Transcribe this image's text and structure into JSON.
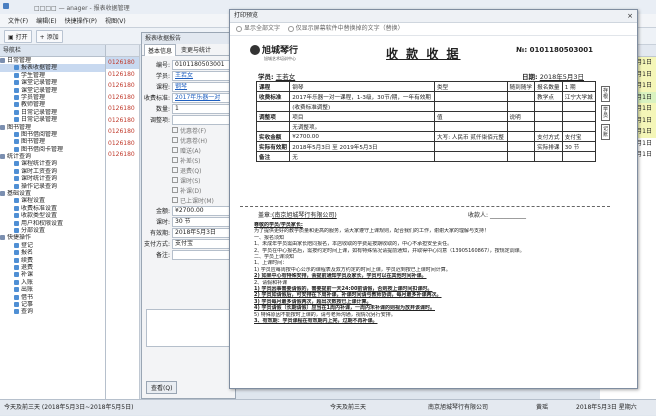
{
  "window": {
    "title": "□□□□ — anager - 报表收据管理"
  },
  "menu": [
    "文件(F)",
    "编辑(E)",
    "快捷操作(P)",
    "视图(V)"
  ],
  "toolbar": {
    "open": "打开",
    "add": "添加"
  },
  "sidebar": {
    "header": "导航栏",
    "items": [
      {
        "label": "日常管理",
        "level": 0
      },
      {
        "label": "报表收据管理",
        "level": 1
      },
      {
        "label": "学生管理",
        "level": 1
      },
      {
        "label": "课堂记录管理",
        "level": 1
      },
      {
        "label": "课堂记录管理",
        "level": 1
      },
      {
        "label": "学员管理",
        "level": 1
      },
      {
        "label": "教师管理",
        "level": 1
      },
      {
        "label": "日常记录管理",
        "level": 1
      },
      {
        "label": "日常记录管理",
        "level": 1
      },
      {
        "label": "图书管理",
        "level": 0
      },
      {
        "label": "图书借阅管理",
        "level": 1
      },
      {
        "label": "图书管理",
        "level": 1
      },
      {
        "label": "图书借阅卡管理",
        "level": 1
      },
      {
        "label": "统计查询",
        "level": 0
      },
      {
        "label": "课程统计查询",
        "level": 1
      },
      {
        "label": "课时工资查询",
        "level": 1
      },
      {
        "label": "课时统计查询",
        "level": 1
      },
      {
        "label": "操作记录查询",
        "level": 1
      },
      {
        "label": "基础设置",
        "level": 0
      },
      {
        "label": "课程设置",
        "level": 1
      },
      {
        "label": "收费标准设置",
        "level": 1
      },
      {
        "label": "收款类型设置",
        "level": 1
      },
      {
        "label": "用户和权限设置",
        "level": 1
      },
      {
        "label": "分部设置",
        "level": 1
      },
      {
        "label": "快捷操作",
        "level": 0
      },
      {
        "label": "登记",
        "level": 1
      },
      {
        "label": "报名",
        "level": 1
      },
      {
        "label": "续费",
        "level": 1
      },
      {
        "label": "退费",
        "level": 1
      },
      {
        "label": "补课",
        "level": 1
      },
      {
        "label": "入账",
        "level": 1
      },
      {
        "label": "出账",
        "level": 1
      },
      {
        "label": "借书",
        "level": 1
      },
      {
        "label": "记事",
        "level": 1
      },
      {
        "label": "查询",
        "level": 1
      }
    ]
  },
  "list": {
    "rows": [
      "0126180",
      "0126180",
      "0126180",
      "0126180",
      "0126180",
      "0126180",
      "0126180",
      "0126180",
      "0126180"
    ]
  },
  "form": {
    "title": "报表收据报告",
    "tabs": [
      "基本信息",
      "变更与统计"
    ],
    "fields": [
      {
        "label": "编号:",
        "value": "0101180503001",
        "link": false
      },
      {
        "label": "学员:",
        "value": "王若女",
        "link": true
      },
      {
        "label": "课程:",
        "value": "钢琴",
        "link": true
      },
      {
        "label": "收费标准:",
        "value": "2017年乐器一对",
        "link": true
      },
      {
        "label": "数量:",
        "value": "1",
        "link": false
      },
      {
        "label": "调整项:",
        "value": "",
        "link": false
      }
    ],
    "checks": [
      "优惠卷(F)",
      "优惠卷(H)",
      "赠送(A)",
      "补差(S)",
      "退费(Q)",
      "课时(S)",
      "补课(D)",
      "已上课时(M)"
    ],
    "fields2": [
      {
        "label": "金额:",
        "value": "¥2700.00"
      },
      {
        "label": "课时:",
        "value": "30 节"
      },
      {
        "label": "有效期:",
        "value": "2018年5月3日"
      },
      {
        "label": "支付方式:",
        "value": "支付宝"
      },
      {
        "label": "备注:",
        "value": ""
      }
    ],
    "query_btn": "查看(Q)"
  },
  "right": {
    "cells": [
      {
        "text": "4月1日",
        "style": "y"
      },
      {
        "text": "4月1日",
        "style": "y"
      },
      {
        "text": "4月1日",
        "style": "y"
      },
      {
        "text": "4月1日",
        "style": "g"
      },
      {
        "text": "4月1日",
        "style": "y"
      },
      {
        "text": "4月1日",
        "style": "y"
      },
      {
        "text": "4月1日",
        "style": "y"
      },
      {
        "text": "4月1日",
        "style": ""
      },
      {
        "text": "4月1日",
        "style": ""
      }
    ]
  },
  "preview": {
    "title": "打印预览",
    "close": "×",
    "opt1": "显示全部文字",
    "opt2": "仅显示屏幕软件中替换掉的文字（替换）",
    "receipt": {
      "logo": "旭城琴行",
      "logo_sub": "旭城艺术培训中心",
      "title": "收 款 收 据",
      "no_label": "№:",
      "no": "0101180503001",
      "student_label": "学员:",
      "student": "王若女",
      "date_label": "日期:",
      "date": "2018年5月3日",
      "rows": [
        [
          "课程",
          "钢琴",
          "类型",
          "随到随学",
          "报名数量",
          "1 期"
        ],
        [
          "收费标准",
          "2017年乐器一对一课程，1-3级，30节/期，一年有效期",
          "",
          "",
          "教学点",
          "江宁大学城"
        ],
        [
          "",
          "(收费标准调整)",
          "",
          "",
          "",
          ""
        ],
        [
          "调整项",
          "项目",
          "值",
          "说明",
          "",
          ""
        ],
        [
          "",
          "无调整项。",
          "",
          "",
          "",
          ""
        ],
        [
          "实收金额",
          "¥2700.00",
          "大写: 人民币 贰仟柒佰元整",
          "",
          "支付方式",
          "支付宝"
        ],
        [
          "实际有效期",
          "2018年5月3日 至 2019年5月3日",
          "",
          "",
          "实际排课",
          "30 节"
        ],
        [
          "备注",
          "无",
          "",
          "",
          "",
          ""
        ]
      ],
      "side": [
        "存根",
        "学员",
        "记账"
      ],
      "org_label": "盖章:",
      "org": "(南京旭城琴行有限公司)",
      "receiver_label": "收款人:",
      "notice": [
        {
          "text": "尊敬的学员/学员家长:",
          "bold": true
        },
        {
          "text": "为了提供更好的教学质量和更高的服务，请大家遵守上课规则，配合我们的工作，谢谢大家的理解与支持！",
          "bold": false
        },
        {
          "text": "一、报名须知",
          "bold": false
        },
        {
          "text": "1、未成年学员需由家长陪同报名，本店收取的学费是按期收取的，中心不承担安全责任。",
          "bold": false
        },
        {
          "text": "2、学员在中心报名后，需按约定时间上课，如有特殊情况请提前通知，并取得中心同意（13905160867），按规定调课。",
          "bold": false
        },
        {
          "text": "二、学员上课须知",
          "bold": false
        },
        {
          "text": "1、上课时间：",
          "bold": false
        },
        {
          "text": "1) 学员应每周按中心公示的课程表及双方约定的时间上课，学员迟到按已上课时间计算。",
          "bold": false
        },
        {
          "text": "2) 如果中心有特殊安排，会提前通知学员及家长，学员可以在其他时间补课。",
          "bold": true
        },
        {
          "text": "2、请假和补课",
          "bold": false
        },
        {
          "text": "1) 学员因事需要请假的，需要提前一天24:00前请假，否则按上课时间扣课时。",
          "bold": true
        },
        {
          "text": "2) 学员如请假后，可安排在下周补课，补课时间请与教师协调，每月最多补课两次。",
          "bold": true
        },
        {
          "text": "3) 学员每月最多请假两次，超出次数按已上课计算。",
          "bold": true
        },
        {
          "text": "4) 学员请假（长期请假）应当在1周内补课，一周内未补课的则视为放弃该课时。",
          "bold": true
        },
        {
          "text": "5) 特殊原因不能按时上课的，请与老师沟通，视情况另行安排。",
          "bold": false
        },
        {
          "text": "3、有效期：学员课程在有效期内上完，过期不再补课。",
          "bold": true
        }
      ]
    }
  },
  "status": {
    "left": "今天及前三天 (2018年5月3日~2018年5月5日)",
    "mid": "今天及前三天",
    "company": "南京旭城琴行有限公司",
    "user": "黄瑶",
    "date": "2018年5月3日 星期六"
  }
}
